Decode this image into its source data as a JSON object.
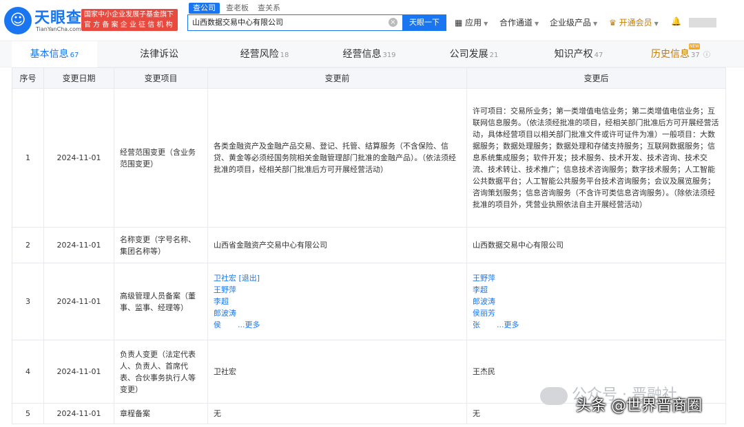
{
  "header": {
    "brand": "天眼查",
    "brand_sub": "TianYanCha.com",
    "badge_line1": "国家中小企业发展子基金旗下",
    "badge_line2": "官 方 备 案 企 业 征 信 机 构",
    "search_tabs": [
      "查公司",
      "查老板",
      "查关系"
    ],
    "search_value": "山西数据交易中心有限公司",
    "search_button": "天眼一下",
    "nav": [
      "应用",
      "合作通道",
      "企业级产品",
      "开通会员"
    ],
    "new_tag": "NEW"
  },
  "tabs": [
    {
      "label": "基本信息",
      "count": "67"
    },
    {
      "label": "法律诉讼",
      "count": ""
    },
    {
      "label": "经营风险",
      "count": "18"
    },
    {
      "label": "经营信息",
      "count": "319"
    },
    {
      "label": "公司发展",
      "count": "21"
    },
    {
      "label": "知识产权",
      "count": "47"
    },
    {
      "label": "历史信息",
      "count": "37"
    }
  ],
  "table": {
    "headers": [
      "序号",
      "变更日期",
      "变更项目",
      "变更前",
      "变更后"
    ],
    "rows": [
      {
        "no": "1",
        "date": "2024-11-01",
        "item": "经营范围变更（含业务范围变更）",
        "before": "各类金融资产及金融产品交易、登记、托管、结算服务（不含保险、信贷、黄金等必须经国务院相关金融管理部门批准的金融产品）。（依法须经批准的项目，经相关部门批准后方可开展经营活动）",
        "after": "许可项目：交易所业务；第一类增值电信业务；第二类增值电信业务；互联网信息服务。（依法须经批准的项目，经相关部门批准后方可开展经营活动，具体经营项目以相关部门批准文件或许可证件为准）一般项目：大数据服务；数据处理服务；数据处理和存储支持服务；互联网数据服务；信息系统集成服务；软件开发；技术服务、技术开发、技术咨询、技术交流、技术转让、技术推广；信息技术咨询服务；数字技术服务；人工智能公共数据平台；人工智能公共服务平台技术咨询服务；会议及展览服务；咨询策划服务；信息咨询服务（不含许可类信息咨询服务）。（除依法须经批准的项目外，凭营业执照依法自主开展经营活动）"
      },
      {
        "no": "2",
        "date": "2024-11-01",
        "item": "名称变更（字号名称、集团名称等）",
        "before": "山西省金融资产交易中心有限公司",
        "after": "山西数据交易中心有限公司"
      },
      {
        "no": "3",
        "date": "2024-11-01",
        "item": "高级管理人员备案（董事、监事、经理等）",
        "before_people": [
          "卫社宏 [退出]",
          "王野萍",
          "李超",
          "郎波涛",
          "侯"
        ],
        "after_people": [
          "王野萍",
          "李超",
          "郎波涛",
          "侯丽芳",
          "张"
        ],
        "more": "...更多"
      },
      {
        "no": "4",
        "date": "2024-11-01",
        "item": "负责人变更（法定代表人、负责人、首席代表、合伙事务执行人等变更）",
        "before": "卫社宏",
        "after": "王杰民"
      },
      {
        "no": "5",
        "date": "2024-11-01",
        "item": "章程备案",
        "before": "无",
        "after": "无"
      }
    ]
  },
  "overlay": {
    "watermark": "公众号 · 晋融社",
    "headline": "头条 @世界晋商圈"
  }
}
